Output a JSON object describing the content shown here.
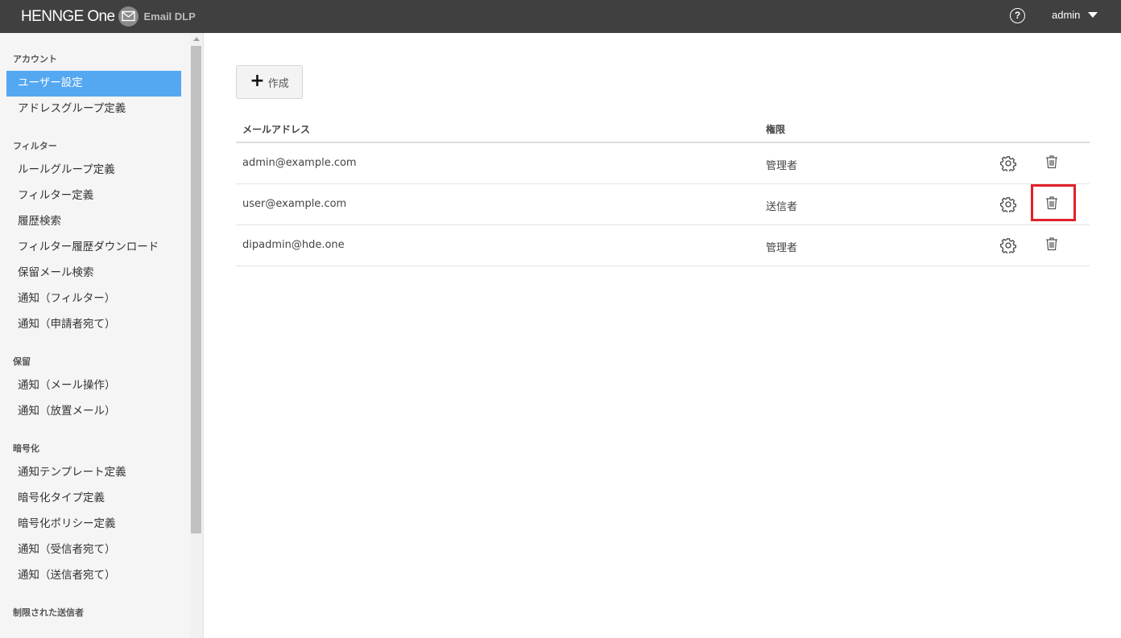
{
  "header": {
    "brand": "HENNGE One",
    "product": "Email DLP",
    "user": "admin"
  },
  "sidebar": {
    "sections": [
      {
        "title": "アカウント",
        "items": [
          "ユーザー設定",
          "アドレスグループ定義"
        ]
      },
      {
        "title": "フィルター",
        "items": [
          "ルールグループ定義",
          "フィルター定義",
          "履歴検索",
          "フィルター履歴ダウンロード",
          "保留メール検索",
          "通知（フィルター）",
          "通知（申請者宛て）"
        ]
      },
      {
        "title": "保留",
        "items": [
          "通知（メール操作）",
          "通知（放置メール）"
        ]
      },
      {
        "title": "暗号化",
        "items": [
          "通知テンプレート定義",
          "暗号化タイプ定義",
          "暗号化ポリシー定義",
          "通知（受信者宛て）",
          "通知（送信者宛て）"
        ]
      },
      {
        "title": "制限された送信者",
        "items": []
      }
    ],
    "active_item": "ユーザー設定"
  },
  "main": {
    "create_label": "作成",
    "table": {
      "columns": [
        "メールアドレス",
        "権限"
      ],
      "rows": [
        {
          "email": "admin@example.com",
          "role": "管理者"
        },
        {
          "email": "user@example.com",
          "role": "送信者"
        },
        {
          "email": "dipadmin@hde.one",
          "role": "管理者"
        }
      ]
    },
    "highlight_color": "#e0202a"
  },
  "colors": {
    "topbar": "#404040",
    "active": "#54a8f2"
  }
}
